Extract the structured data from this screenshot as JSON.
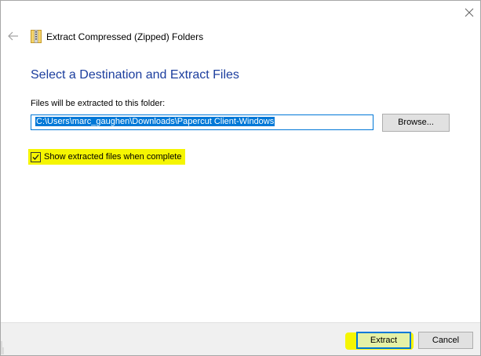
{
  "window": {
    "title": "Extract Compressed (Zipped) Folders",
    "icons": {
      "close": "close-icon",
      "back": "back-arrow-icon",
      "app": "zip-folder-icon"
    }
  },
  "main": {
    "heading": "Select a Destination and Extract Files",
    "destination_label": "Files will be extracted to this folder:",
    "destination_path": "C:\\Users\\marc_gaughen\\Downloads\\Papercut Client-Windows",
    "browse_label": "Browse...",
    "show_files_label": "Show extracted files when complete",
    "show_files_checked": true
  },
  "footer": {
    "extract_label": "Extract",
    "cancel_label": "Cancel"
  },
  "colors": {
    "heading": "#1c3e9e",
    "accent": "#0078d7",
    "highlight": "#f5f502"
  }
}
